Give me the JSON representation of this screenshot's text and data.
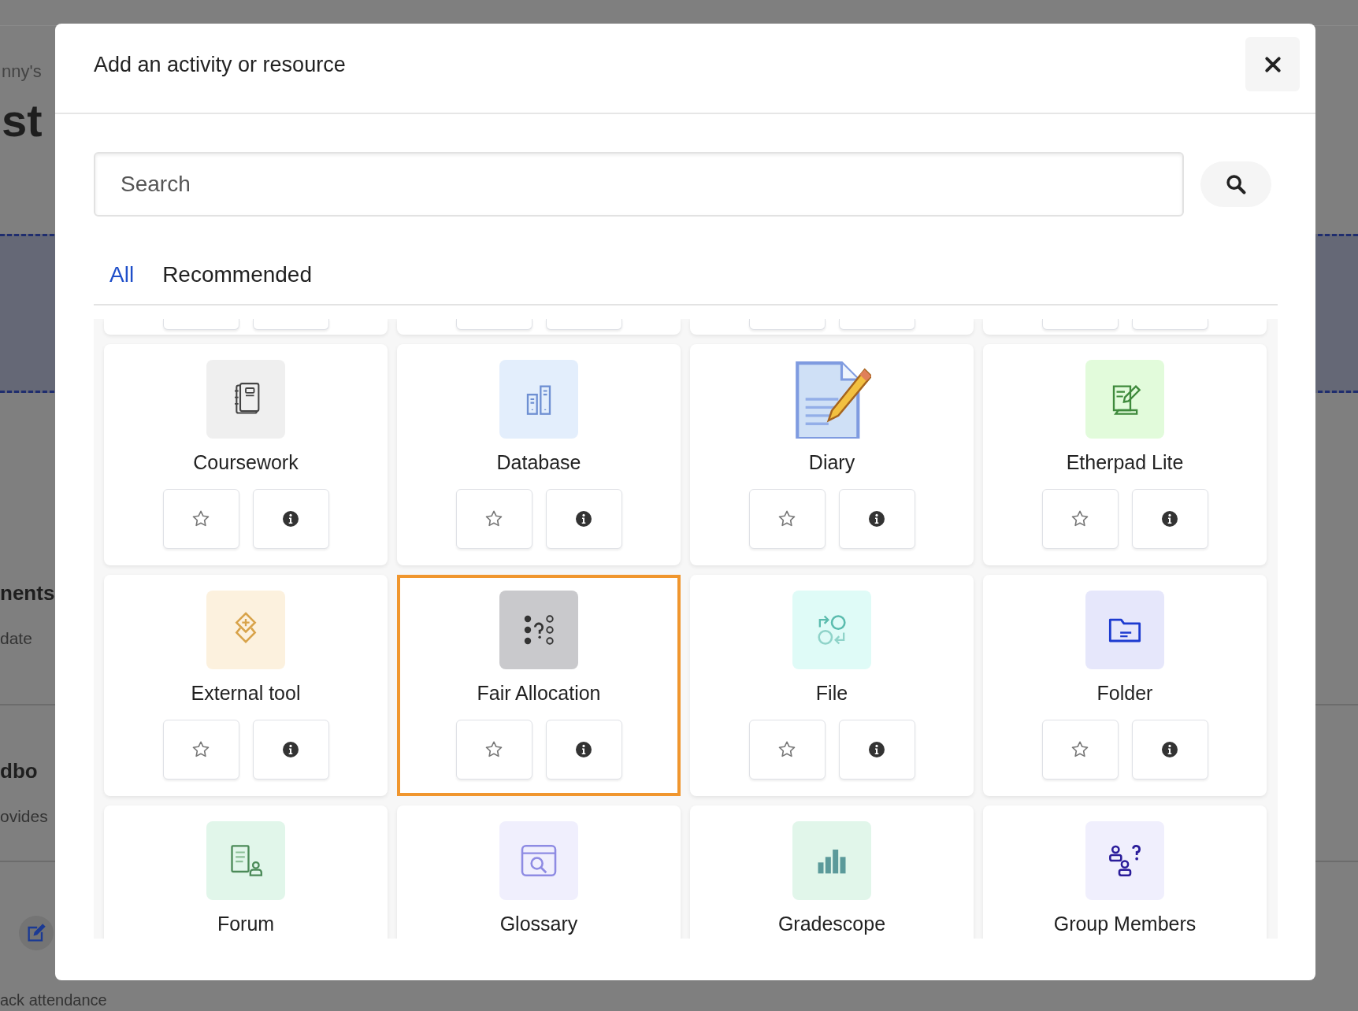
{
  "background_page": {
    "breadcrumb": "nny's",
    "heading": "st",
    "sections": [
      {
        "title": "nents",
        "text": "date"
      },
      {
        "title": "dbo",
        "text": "ovides"
      }
    ],
    "footer_text": "ack attendance"
  },
  "dialog": {
    "title": "Add an activity or resource",
    "search": {
      "placeholder": "Search"
    },
    "tabs": [
      {
        "label": "All",
        "selected": true
      },
      {
        "label": "Recommended",
        "selected": false
      }
    ],
    "items": [
      {
        "name": "Coursework",
        "kind": "coursework",
        "selected": false
      },
      {
        "name": "Database",
        "kind": "database",
        "selected": false
      },
      {
        "name": "Diary",
        "kind": "diary",
        "selected": false
      },
      {
        "name": "Etherpad Lite",
        "kind": "etherpad",
        "selected": false
      },
      {
        "name": "External tool",
        "kind": "external",
        "selected": false
      },
      {
        "name": "Fair Allocation",
        "kind": "allocation",
        "selected": true
      },
      {
        "name": "File",
        "kind": "file",
        "selected": false
      },
      {
        "name": "Folder",
        "kind": "folder",
        "selected": false
      },
      {
        "name": "Forum",
        "kind": "forum",
        "selected": false
      },
      {
        "name": "Glossary",
        "kind": "glossary",
        "selected": false
      },
      {
        "name": "Gradescope",
        "kind": "gradescope",
        "selected": false
      },
      {
        "name": "Group Members",
        "kind": "groupmembers",
        "selected": false
      }
    ]
  }
}
